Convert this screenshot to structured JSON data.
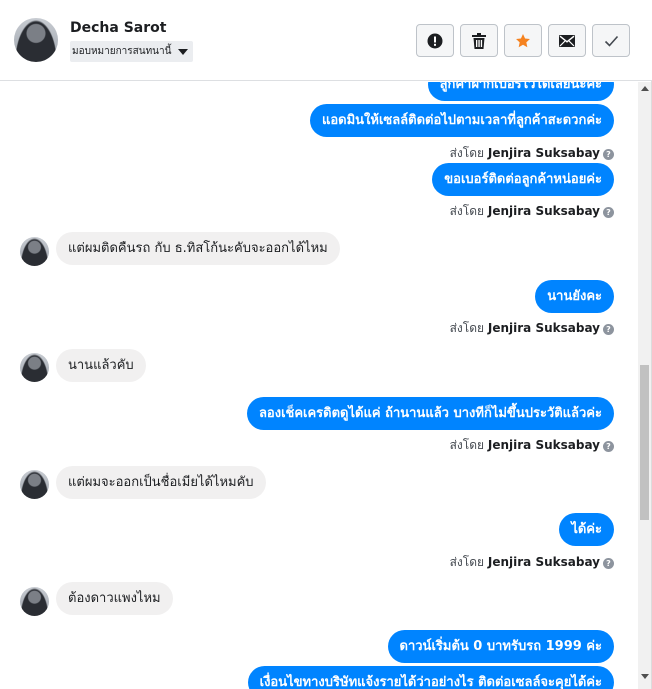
{
  "contact": {
    "name": "Decha Sarot",
    "assign_label": "มอบหมายการสนทนานี้"
  },
  "toolbar": {
    "spam": "spam-icon",
    "delete": "trash-icon",
    "star": "star-icon",
    "mail": "mail-icon",
    "done": "check-icon",
    "star_color": "#f5821f"
  },
  "colors": {
    "outgoing_bubble": "#0084ff",
    "incoming_bubble": "#f1f0f0"
  },
  "messages": [
    {
      "dir": "out",
      "text": "ลูกค้าฝากเบอร์ไว้ได้เลยนะคะ",
      "partial": true
    },
    {
      "dir": "out",
      "text": "แอดมินให้เซลล์ติดต่อไปตามเวลาที่ลูกค้าสะดวกค่ะ"
    },
    {
      "dir": "meta",
      "prefix": "ส่งโดย",
      "sender": "Jenjira Suksabay"
    },
    {
      "dir": "out",
      "text": "ขอเบอร์ติดต่อลูกค้าหน่อยค่ะ"
    },
    {
      "dir": "meta",
      "prefix": "ส่งโดย",
      "sender": "Jenjira Suksabay"
    },
    {
      "dir": "in",
      "text": "แต่ผมติดคืนรถ กับ ธ.ทิสโก้นะคับจะออกได้ไหม"
    },
    {
      "dir": "out",
      "text": "นานยังคะ"
    },
    {
      "dir": "meta",
      "prefix": "ส่งโดย",
      "sender": "Jenjira Suksabay"
    },
    {
      "dir": "in",
      "text": "นานแล้วคับ"
    },
    {
      "dir": "out",
      "text": "ลองเช็คเครดิตดูได้แค่ ถ้านานแล้ว บางทีก็ไม่ขึ้นประวัติแล้วค่ะ"
    },
    {
      "dir": "meta",
      "prefix": "ส่งโดย",
      "sender": "Jenjira Suksabay"
    },
    {
      "dir": "in",
      "text": "แต่ผมจะออกเป็นชื่อเมียได้ไหมคับ"
    },
    {
      "dir": "out",
      "text": "ได้ค่ะ"
    },
    {
      "dir": "meta",
      "prefix": "ส่งโดย",
      "sender": "Jenjira Suksabay"
    },
    {
      "dir": "in",
      "text": "ต้องดาวแพงไหม"
    },
    {
      "dir": "out",
      "text": "ดาวน์เริ่มต้น 0 บาทรับรถ 1999 ค่ะ"
    },
    {
      "dir": "out",
      "text": "เงื่อนไขทางบริษัทแจ้งรายได้ว่าอย่างไร ติดต่อเซลล์จะคุยได้ค่ะ",
      "partial": true
    }
  ]
}
